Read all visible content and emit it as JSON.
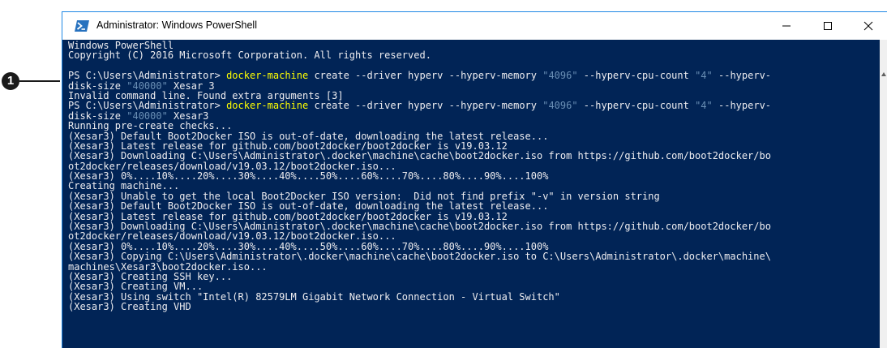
{
  "callout": {
    "number": "1"
  },
  "window": {
    "title": "Administrator: Windows PowerShell",
    "controls": {
      "minimize": "minimize-icon",
      "maximize": "maximize-icon",
      "close": "close-icon"
    }
  },
  "colors": {
    "console_bg": "#012456",
    "text": "#eeedf0",
    "command": "#ffff00",
    "string": "#6a8fb5"
  },
  "terminal": {
    "lines": [
      [
        {
          "t": "Windows PowerShell",
          "k": "n"
        }
      ],
      [
        {
          "t": "Copyright (C) 2016 Microsoft Corporation. All rights reserved.",
          "k": "n"
        }
      ],
      [
        {
          "t": "",
          "k": "n"
        }
      ],
      [
        {
          "t": "PS C:\\Users\\Administrator> ",
          "k": "n"
        },
        {
          "t": "docker-machine",
          "k": "c"
        },
        {
          "t": " create --driver hyperv --hyperv-memory ",
          "k": "n"
        },
        {
          "t": "\"4096\"",
          "k": "s"
        },
        {
          "t": " --hyperv-cpu-count ",
          "k": "n"
        },
        {
          "t": "\"4\"",
          "k": "s"
        },
        {
          "t": " --hyperv-",
          "k": "n"
        }
      ],
      [
        {
          "t": "disk-size ",
          "k": "n"
        },
        {
          "t": "\"40000\"",
          "k": "s"
        },
        {
          "t": " Xesar 3",
          "k": "n"
        }
      ],
      [
        {
          "t": "Invalid command line. Found extra arguments [3]",
          "k": "n"
        }
      ],
      [
        {
          "t": "PS C:\\Users\\Administrator> ",
          "k": "n"
        },
        {
          "t": "docker-machine",
          "k": "c"
        },
        {
          "t": " create --driver hyperv --hyperv-memory ",
          "k": "n"
        },
        {
          "t": "\"4096\"",
          "k": "s"
        },
        {
          "t": " --hyperv-cpu-count ",
          "k": "n"
        },
        {
          "t": "\"4\"",
          "k": "s"
        },
        {
          "t": " --hyperv-",
          "k": "n"
        }
      ],
      [
        {
          "t": "disk-size ",
          "k": "n"
        },
        {
          "t": "\"40000\"",
          "k": "s"
        },
        {
          "t": " Xesar3",
          "k": "n"
        }
      ],
      [
        {
          "t": "Running pre-create checks...",
          "k": "n"
        }
      ],
      [
        {
          "t": "(Xesar3) Default Boot2Docker ISO is out-of-date, downloading the latest release...",
          "k": "n"
        }
      ],
      [
        {
          "t": "(Xesar3) Latest release for github.com/boot2docker/boot2docker is v19.03.12",
          "k": "n"
        }
      ],
      [
        {
          "t": "(Xesar3) Downloading C:\\Users\\Administrator\\.docker\\machine\\cache\\boot2docker.iso from https://github.com/boot2docker/bo",
          "k": "n"
        }
      ],
      [
        {
          "t": "ot2docker/releases/download/v19.03.12/boot2docker.iso...",
          "k": "n"
        }
      ],
      [
        {
          "t": "(Xesar3) 0%....10%....20%....30%....40%....50%....60%....70%....80%....90%....100%",
          "k": "n"
        }
      ],
      [
        {
          "t": "Creating machine...",
          "k": "n"
        }
      ],
      [
        {
          "t": "(Xesar3) Unable to get the local Boot2Docker ISO version:  Did not find prefix \"-v\" in version string",
          "k": "n"
        }
      ],
      [
        {
          "t": "(Xesar3) Default Boot2Docker ISO is out-of-date, downloading the latest release...",
          "k": "n"
        }
      ],
      [
        {
          "t": "(Xesar3) Latest release for github.com/boot2docker/boot2docker is v19.03.12",
          "k": "n"
        }
      ],
      [
        {
          "t": "(Xesar3) Downloading C:\\Users\\Administrator\\.docker\\machine\\cache\\boot2docker.iso from https://github.com/boot2docker/bo",
          "k": "n"
        }
      ],
      [
        {
          "t": "ot2docker/releases/download/v19.03.12/boot2docker.iso...",
          "k": "n"
        }
      ],
      [
        {
          "t": "(Xesar3) 0%....10%....20%....30%....40%....50%....60%....70%....80%....90%....100%",
          "k": "n"
        }
      ],
      [
        {
          "t": "(Xesar3) Copying C:\\Users\\Administrator\\.docker\\machine\\cache\\boot2docker.iso to C:\\Users\\Administrator\\.docker\\machine\\",
          "k": "n"
        }
      ],
      [
        {
          "t": "machines\\Xesar3\\boot2docker.iso...",
          "k": "n"
        }
      ],
      [
        {
          "t": "(Xesar3) Creating SSH key...",
          "k": "n"
        }
      ],
      [
        {
          "t": "(Xesar3) Creating VM...",
          "k": "n"
        }
      ],
      [
        {
          "t": "(Xesar3) Using switch \"Intel(R) 82579LM Gigabit Network Connection - Virtual Switch\"",
          "k": "n"
        }
      ],
      [
        {
          "t": "(Xesar3) Creating VHD",
          "k": "n"
        }
      ]
    ]
  }
}
